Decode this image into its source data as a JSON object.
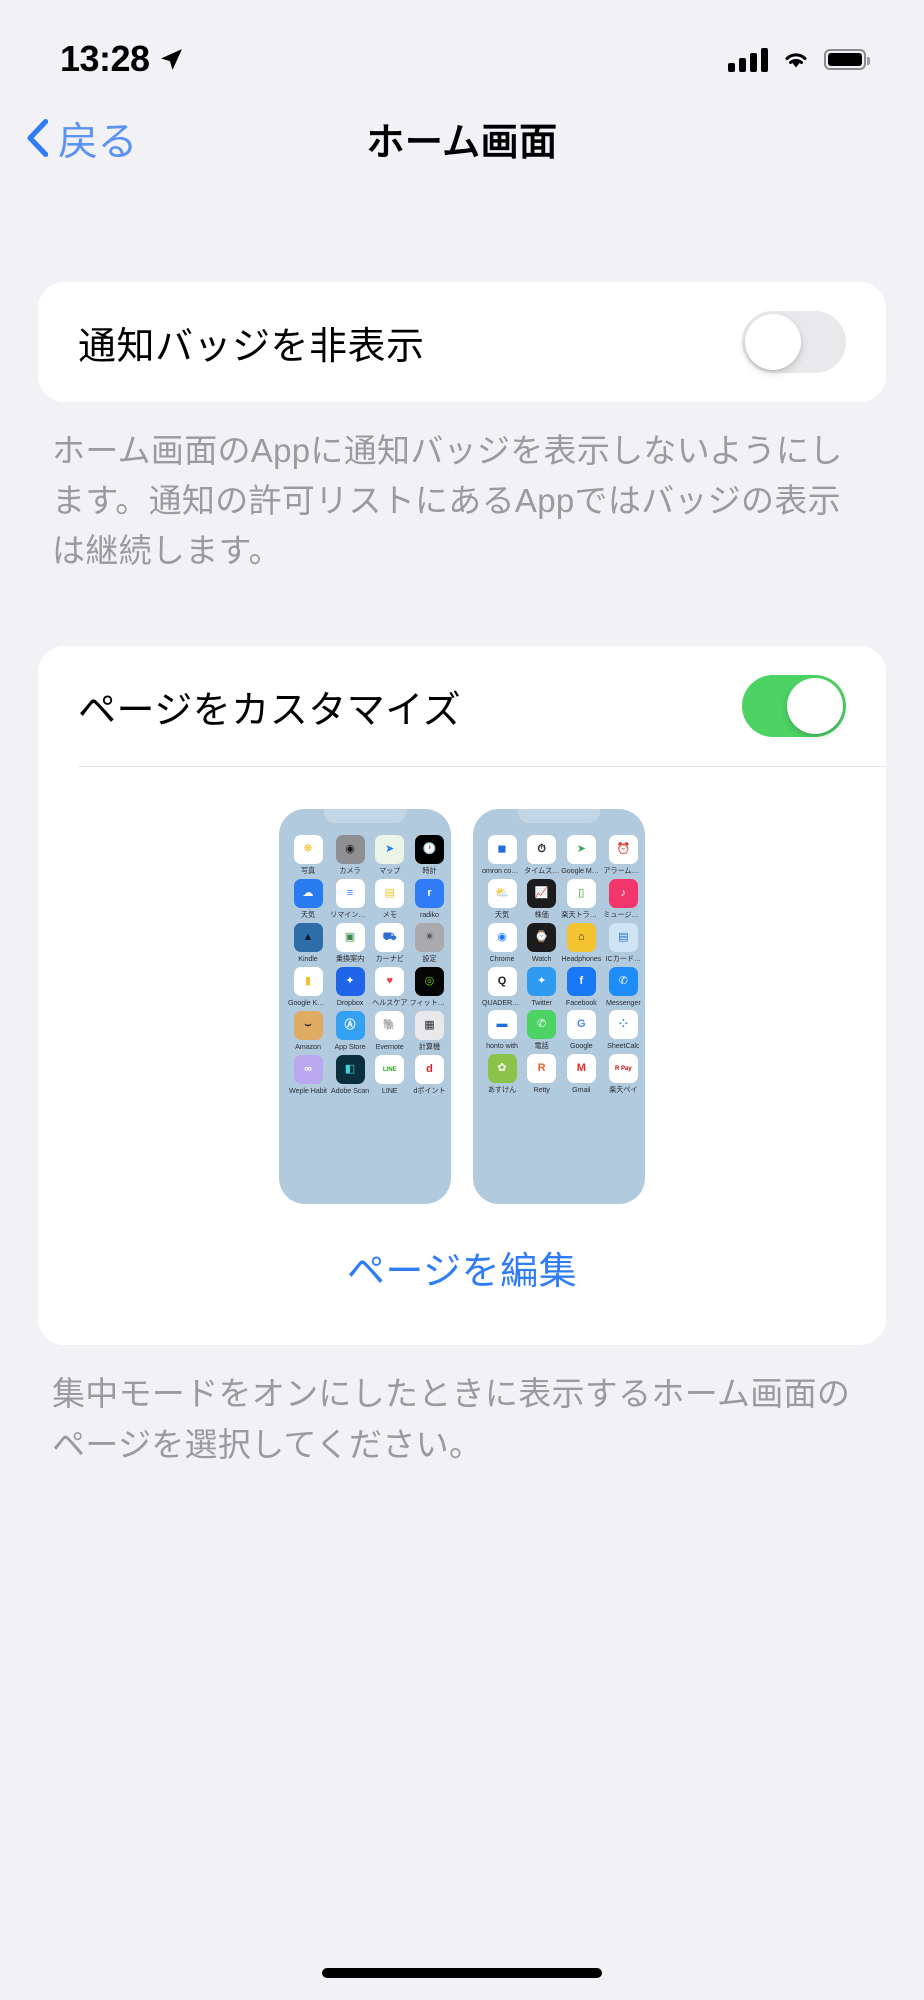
{
  "status_bar": {
    "time": "13:28",
    "location_icon": "location-arrow-icon",
    "signal_icon": "cellular-signal-icon",
    "wifi_icon": "wifi-icon",
    "battery_icon": "battery-icon"
  },
  "nav": {
    "back_label": "戻る",
    "back_icon": "chevron-left-icon",
    "title": "ホーム画面"
  },
  "sections": [
    {
      "row_label": "通知バッジを非表示",
      "toggle_state": "off",
      "footer": "ホーム画面のAppに通知バッジを表示しないようにします。通知の許可リストにあるAppではバッジの表示は継続します。"
    },
    {
      "row_label": "ページをカスタマイズ",
      "toggle_state": "on",
      "edit_link": "ページを編集",
      "footer": "集中モードをオンにしたときに表示するホーム画面のページを選択してください。"
    }
  ],
  "colors": {
    "accent_blue": "#2f7cf6",
    "toggle_on_green": "#4cd364",
    "toggle_off_gray": "#e9e9eb",
    "page_background": "#f2f1f6",
    "card_background": "#ffffff",
    "footer_text": "#9a9aa0",
    "phone_background": "#b2cade"
  },
  "home_screen_previews": [
    {
      "page": 1,
      "apps": [
        {
          "name": "写真",
          "icon": "photos-icon",
          "bg": "#ffffff",
          "glyph": "❋",
          "fg": "#f6c02d"
        },
        {
          "name": "カメラ",
          "icon": "camera-icon",
          "bg": "#8e8e93",
          "glyph": "◉",
          "fg": "#1c1c1e"
        },
        {
          "name": "マップ",
          "icon": "maps-icon",
          "bg": "#eaf4e7",
          "glyph": "➤",
          "fg": "#1f7bf6"
        },
        {
          "name": "時計",
          "icon": "clock-icon",
          "bg": "#000000",
          "glyph": "🕐",
          "fg": "#ffffff"
        },
        {
          "name": "天気",
          "icon": "weather-icon",
          "bg": "#2a7bf0",
          "glyph": "☁",
          "fg": "#ffffff"
        },
        {
          "name": "リマインダー",
          "icon": "reminders-icon",
          "bg": "#ffffff",
          "glyph": "≡",
          "fg": "#2f7cf6"
        },
        {
          "name": "メモ",
          "icon": "notes-icon",
          "bg": "#ffffff",
          "glyph": "▤",
          "fg": "#f5c231"
        },
        {
          "name": "radiko",
          "icon": "radiko-icon",
          "bg": "#2f7cf6",
          "glyph": "r",
          "fg": "#ffffff"
        },
        {
          "name": "Kindle",
          "icon": "kindle-icon",
          "bg": "#2e6ea8",
          "glyph": "▲",
          "fg": "#0b1b2a"
        },
        {
          "name": "乗換案内",
          "icon": "transit-icon",
          "bg": "#ffffff",
          "glyph": "▣",
          "fg": "#3c8a4e"
        },
        {
          "name": "カーナビ",
          "icon": "carnavi-icon",
          "bg": "#ffffff",
          "glyph": "⛟",
          "fg": "#2d6fd0"
        },
        {
          "name": "設定",
          "icon": "settings-icon",
          "bg": "#a9a9ae",
          "glyph": "✷",
          "fg": "#58585c"
        },
        {
          "name": "Google Keep",
          "icon": "google-keep-icon",
          "bg": "#ffffff",
          "glyph": "▮",
          "fg": "#f5c231"
        },
        {
          "name": "Dropbox",
          "icon": "dropbox-icon",
          "bg": "#1f63e8",
          "glyph": "✦",
          "fg": "#ffffff"
        },
        {
          "name": "ヘルスケア",
          "icon": "health-icon",
          "bg": "#ffffff",
          "glyph": "♥",
          "fg": "#f03b4a"
        },
        {
          "name": "フィットネス",
          "icon": "fitness-icon",
          "bg": "#050505",
          "glyph": "◎",
          "fg": "#7ed321"
        },
        {
          "name": "Amazon",
          "icon": "amazon-icon",
          "bg": "#e0ab63",
          "glyph": "⌣",
          "fg": "#26262a"
        },
        {
          "name": "App Store",
          "icon": "app-store-icon",
          "bg": "#34a0f2",
          "glyph": "Ⓐ",
          "fg": "#ffffff"
        },
        {
          "name": "Evernote",
          "icon": "evernote-icon",
          "bg": "#ffffff",
          "glyph": "🐘",
          "fg": "#4caf50"
        },
        {
          "name": "計算機",
          "icon": "calculator-icon",
          "bg": "#e9e9eb",
          "glyph": "▦",
          "fg": "#2b2b2f"
        },
        {
          "name": "Weple Habit",
          "icon": "weple-habit-icon",
          "bg": "#b9a7ef",
          "glyph": "∞",
          "fg": "#ffffff"
        },
        {
          "name": "Adobe Scan",
          "icon": "adobe-scan-icon",
          "bg": "#0b2e3c",
          "glyph": "◧",
          "fg": "#39d6e0"
        },
        {
          "name": "LINE",
          "icon": "line-icon",
          "bg": "#ffffff",
          "glyph": "LINE",
          "fg": "#2aa515"
        },
        {
          "name": "dポイント",
          "icon": "d-point-icon",
          "bg": "#ffffff",
          "glyph": "d",
          "fg": "#d8232a"
        }
      ]
    },
    {
      "page": 2,
      "apps": [
        {
          "name": "omron conn…",
          "icon": "omron-connect-icon",
          "bg": "#ffffff",
          "glyph": "◼",
          "fg": "#1e6fd9"
        },
        {
          "name": "タイムス…",
          "icon": "times-icon",
          "bg": "#ffffff",
          "glyph": "⏱",
          "fg": "#1c1c1e"
        },
        {
          "name": "Google Maps",
          "icon": "google-maps-icon",
          "bg": "#ffffff",
          "glyph": "➤",
          "fg": "#34a853"
        },
        {
          "name": "アラーム&タイマー",
          "icon": "alarm-timer-icon",
          "bg": "#ffffff",
          "glyph": "⏰",
          "fg": "#4a90d9"
        },
        {
          "name": "天気",
          "icon": "yahoo-weather-icon",
          "bg": "#ffffff",
          "glyph": "⛅",
          "fg": "#f58220"
        },
        {
          "name": "株価",
          "icon": "stocks-icon",
          "bg": "#1c1c1e",
          "glyph": "📈",
          "fg": "#ffffff"
        },
        {
          "name": "楽天トラベル",
          "icon": "rakuten-travel-icon",
          "bg": "#ffffff",
          "glyph": "▯",
          "fg": "#2aa515"
        },
        {
          "name": "ミュージック",
          "icon": "music-icon",
          "bg": "#f0366b",
          "glyph": "♪",
          "fg": "#ffffff"
        },
        {
          "name": "Chrome",
          "icon": "chrome-icon",
          "bg": "#ffffff",
          "glyph": "◉",
          "fg": "#1f7bf6"
        },
        {
          "name": "Watch",
          "icon": "watch-icon",
          "bg": "#1c1c1e",
          "glyph": "⌚",
          "fg": "#ffffff"
        },
        {
          "name": "Headphones",
          "icon": "headphones-icon",
          "bg": "#f4c430",
          "glyph": "⌂",
          "fg": "#26262a"
        },
        {
          "name": "ICカード…",
          "icon": "ic-card-icon",
          "bg": "#cfe5f5",
          "glyph": "▤",
          "fg": "#2d6fd0"
        },
        {
          "name": "QUADERNO",
          "icon": "quaderno-icon",
          "bg": "#ffffff",
          "glyph": "Q",
          "fg": "#1c1c1e"
        },
        {
          "name": "Twitter",
          "icon": "twitter-icon",
          "bg": "#2f9bf0",
          "glyph": "✦",
          "fg": "#ffffff"
        },
        {
          "name": "Facebook",
          "icon": "facebook-icon",
          "bg": "#1877f2",
          "glyph": "f",
          "fg": "#ffffff"
        },
        {
          "name": "Messenger",
          "icon": "messenger-icon",
          "bg": "#1f8df7",
          "glyph": "✆",
          "fg": "#ffffff"
        },
        {
          "name": "honto with",
          "icon": "honto-with-icon",
          "bg": "#ffffff",
          "glyph": "▬",
          "fg": "#1e6fd9"
        },
        {
          "name": "電話",
          "icon": "phone-icon",
          "bg": "#4cd364",
          "glyph": "✆",
          "fg": "#ffffff"
        },
        {
          "name": "Google",
          "icon": "google-icon",
          "bg": "#ffffff",
          "glyph": "G",
          "fg": "#4285f4"
        },
        {
          "name": "SheetCalc",
          "icon": "sheetcalc-icon",
          "bg": "#ffffff",
          "glyph": "⁘",
          "fg": "#2f7cf6"
        },
        {
          "name": "あすけん",
          "icon": "asuken-icon",
          "bg": "#8bc34a",
          "glyph": "✿",
          "fg": "#ffffff"
        },
        {
          "name": "Retty",
          "icon": "retty-icon",
          "bg": "#ffffff",
          "glyph": "R",
          "fg": "#e8642e"
        },
        {
          "name": "Gmail",
          "icon": "gmail-icon",
          "bg": "#ffffff",
          "glyph": "M",
          "fg": "#d93025"
        },
        {
          "name": "楽天ペイ",
          "icon": "rakuten-pay-icon",
          "bg": "#ffffff",
          "glyph": "R Pay",
          "fg": "#bf0000"
        }
      ]
    }
  ]
}
